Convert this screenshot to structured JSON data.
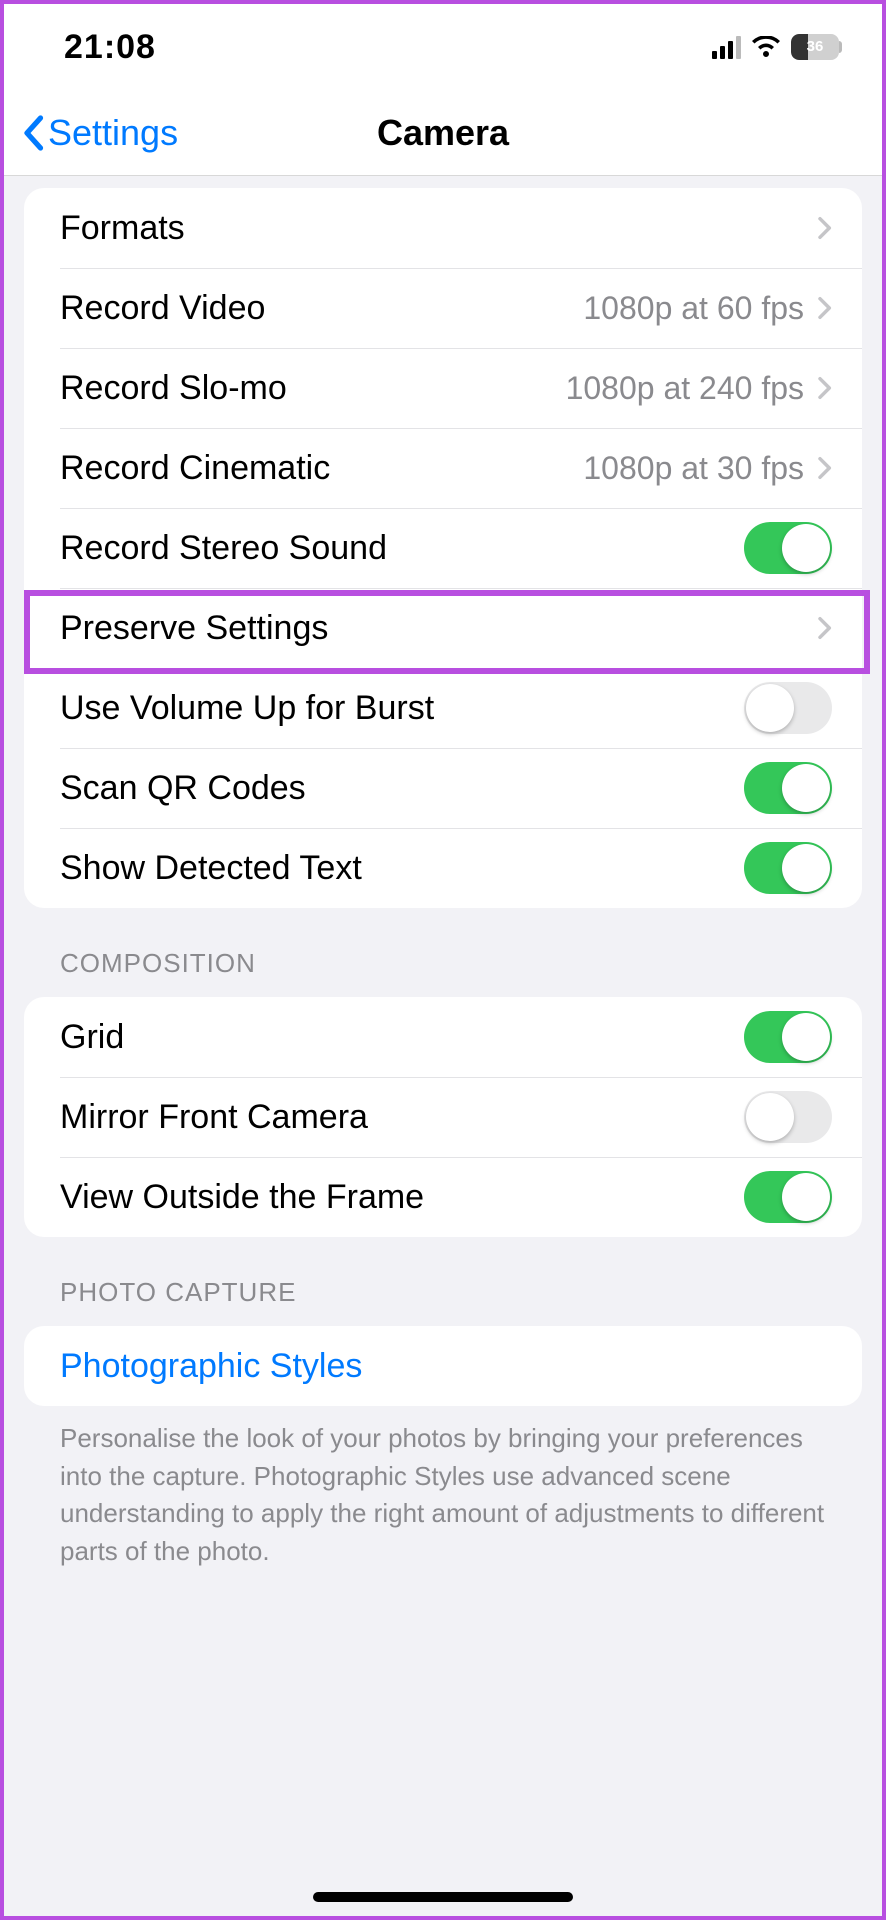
{
  "status": {
    "time": "21:08",
    "battery_pct": "36"
  },
  "nav": {
    "back_label": "Settings",
    "title": "Camera"
  },
  "group1": {
    "formats": "Formats",
    "record_video": {
      "label": "Record Video",
      "value": "1080p at 60 fps"
    },
    "record_slomo": {
      "label": "Record Slo-mo",
      "value": "1080p at 240 fps"
    },
    "record_cinematic": {
      "label": "Record Cinematic",
      "value": "1080p at 30 fps"
    },
    "stereo": "Record Stereo Sound",
    "preserve": "Preserve Settings",
    "volume_burst": "Use Volume Up for Burst",
    "scan_qr": "Scan QR Codes",
    "detected_text": "Show Detected Text"
  },
  "composition": {
    "header": "Composition",
    "grid": "Grid",
    "mirror": "Mirror Front Camera",
    "outside_frame": "View Outside the Frame"
  },
  "photo_capture": {
    "header": "Photo Capture",
    "styles": "Photographic Styles",
    "footer": "Personalise the look of your photos by bringing your preferences into the capture. Photographic Styles use advanced scene understanding to apply the right amount of adjustments to different parts of the photo."
  }
}
